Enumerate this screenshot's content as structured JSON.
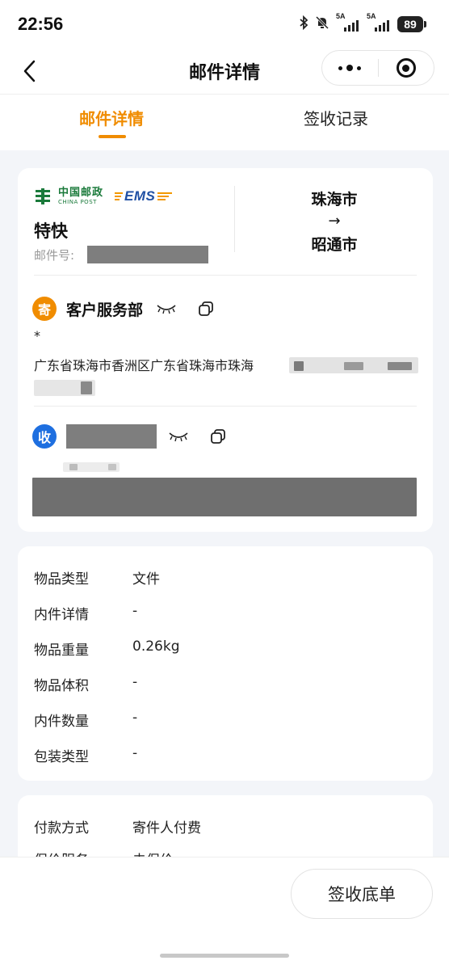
{
  "status_bar": {
    "time": "22:56",
    "signal1_label": "5A",
    "signal2_label": "5A",
    "battery": "89",
    "icons": [
      "bluetooth-icon",
      "mute-bell-icon",
      "signal-icon",
      "signal-icon",
      "battery-icon"
    ]
  },
  "nav": {
    "title": "邮件详情",
    "back_icon": "chevron-left-icon",
    "more_icon": "more-dots-icon",
    "close_icon": "target-circle-icon"
  },
  "tabs": [
    {
      "label": "邮件详情",
      "active": true
    },
    {
      "label": "签收记录",
      "active": false
    }
  ],
  "accent_color": "#f08c00",
  "waybill": {
    "brand_cn": "中国邮政",
    "brand_en": "CHINA POST",
    "ems": "EMS",
    "service": "特快",
    "mail_no_label": "邮件号:",
    "origin": "珠海市",
    "arrow": "→",
    "destination": "昭通市"
  },
  "sender": {
    "badge": "寄",
    "name": "客户服务部",
    "phone_masked": "*",
    "address": "广东省珠海市香洲区广东省珠海市珠海",
    "eye_icon": "eye-closed-icon",
    "copy_icon": "copy-icon"
  },
  "receiver": {
    "badge": "收",
    "eye_icon": "eye-closed-icon",
    "copy_icon": "copy-icon"
  },
  "item_info": [
    {
      "key": "物品类型",
      "value": "文件"
    },
    {
      "key": "内件详情",
      "value": "-"
    },
    {
      "key": "物品重量",
      "value": "0.26kg"
    },
    {
      "key": "物品体积",
      "value": "-"
    },
    {
      "key": "内件数量",
      "value": "-"
    },
    {
      "key": "包装类型",
      "value": "-"
    }
  ],
  "payment_info": [
    {
      "key": "付款方式",
      "value": "寄件人付费"
    },
    {
      "key": "保价服务",
      "value": "未保价"
    }
  ],
  "bottom": {
    "receipt_button": "签收底单"
  }
}
